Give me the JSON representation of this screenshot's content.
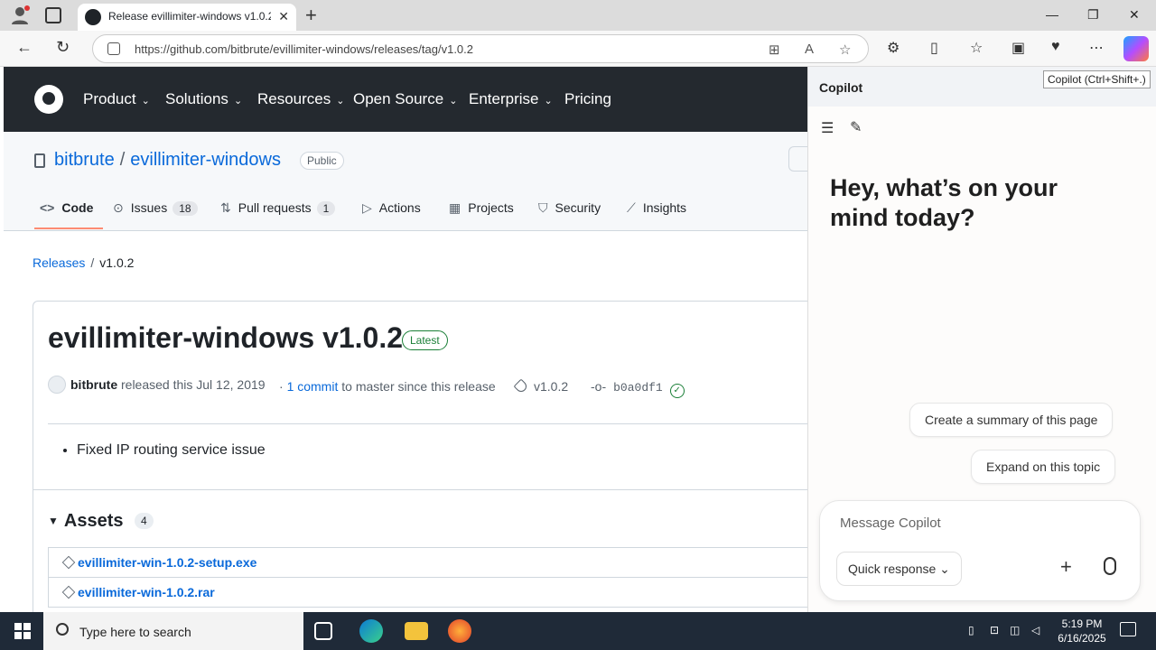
{
  "browser": {
    "tab_title": "Release evillimiter-windows v1.0.2",
    "url": "https://github.com/bitbrute/evillimiter-windows/releases/tag/v1.0.2"
  },
  "gh_nav": {
    "items": [
      "Product",
      "Solutions",
      "Resources",
      "Open Source",
      "Enterprise",
      "Pricing"
    ]
  },
  "repo": {
    "owner": "bitbrute",
    "separator": "/",
    "name": "evillimiter-windows",
    "visibility": "Public",
    "tabs": [
      {
        "label": "Code",
        "count": ""
      },
      {
        "label": "Issues",
        "count": "18"
      },
      {
        "label": "Pull requests",
        "count": "1"
      },
      {
        "label": "Actions",
        "count": ""
      },
      {
        "label": "Projects",
        "count": ""
      },
      {
        "label": "Security",
        "count": ""
      },
      {
        "label": "Insights",
        "count": ""
      }
    ]
  },
  "breadcrumb": {
    "releases": "Releases",
    "sep": "/",
    "current": "v1.0.2"
  },
  "release": {
    "title": "evillimiter-windows v1.0.2",
    "badge": "Latest",
    "author": "bitbrute",
    "released_text": "released this Jul 12, 2019",
    "dot": "·",
    "commits_link": "1 commit",
    "commits_suffix": "to master since this release",
    "tag": "v1.0.2",
    "commit_sha": "b0a0df1",
    "notes": [
      "Fixed IP routing service issue"
    ]
  },
  "assets": {
    "title": "Assets",
    "count": "4",
    "items": [
      "evillimiter-win-1.0.2-setup.exe",
      "evillimiter-win-1.0.2.rar"
    ]
  },
  "copilot": {
    "title": "Copilot",
    "tooltip": "Copilot (Ctrl+Shift+.)",
    "greeting": "Hey, what’s on your mind today?",
    "suggestions": [
      "Create a summary of this page",
      "Expand on this topic"
    ],
    "input_placeholder": "Message Copilot",
    "mode": "Quick response"
  },
  "taskbar": {
    "search_placeholder": "Type here to search",
    "time": "5:19 PM",
    "date": "6/16/2025"
  }
}
